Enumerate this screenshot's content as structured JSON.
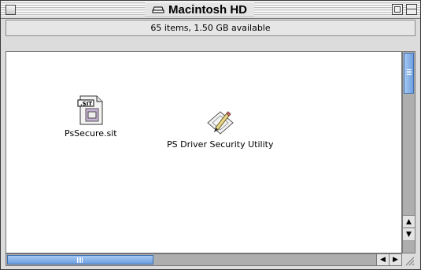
{
  "window": {
    "title": "Macintosh HD",
    "info": "65 items, 1.50 GB available"
  },
  "icons": [
    {
      "label": "PsSecure.sit",
      "icon": "stuffit-archive-icon"
    },
    {
      "label": "PS Driver Security Utility",
      "icon": "utility-app-icon"
    }
  ],
  "colors": {
    "scroll_thumb": "#7fa9e6",
    "scroll_track": "#aeaeae",
    "content_bg": "#ffffff"
  }
}
